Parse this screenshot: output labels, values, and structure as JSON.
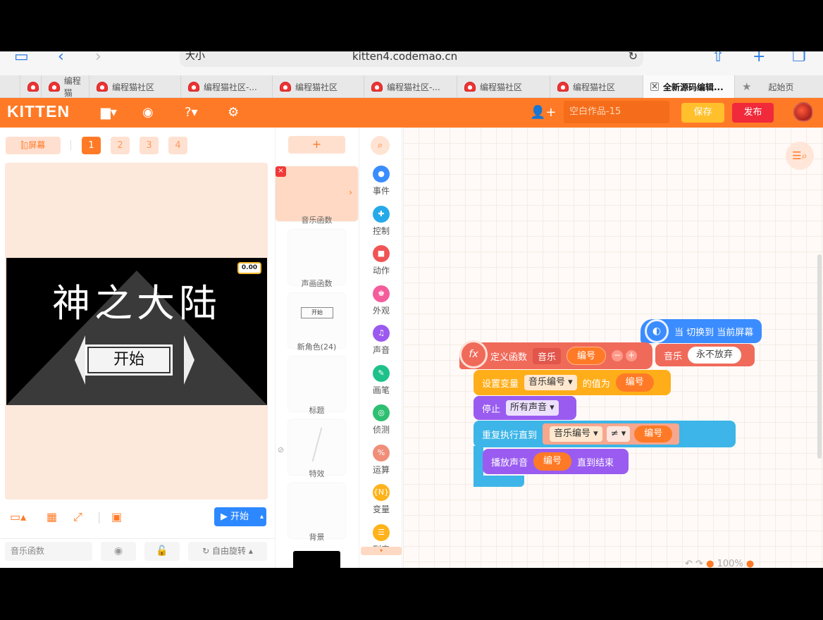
{
  "browser": {
    "url_left": "大小",
    "url": "kitten4.codemao.cn"
  },
  "tabs": [
    {
      "label": "编程猫",
      "active": false
    },
    {
      "label": "编程猫社区",
      "active": false
    },
    {
      "label": "编程猫社区-...",
      "active": false
    },
    {
      "label": "编程猫社区",
      "active": false
    },
    {
      "label": "编程猫社区-...",
      "active": false
    },
    {
      "label": "编程猫社区",
      "active": false
    },
    {
      "label": "编程猫社区",
      "active": false
    },
    {
      "label": "全新源码编辑...",
      "active": true
    },
    {
      "label": "起始页",
      "active": false
    }
  ],
  "header": {
    "logo": "KITTEN",
    "work_name": "空白作品-15",
    "save_label": "保存",
    "publish_label": "发布"
  },
  "stage": {
    "screen_label": "屏幕",
    "pages": [
      "1",
      "2",
      "3",
      "4"
    ],
    "active_page": "1",
    "title": "神之大陆",
    "button_label": "开始",
    "timer": "0.00",
    "start_label": "开始",
    "sprite_name": "音乐函数",
    "rotate_label": "自由旋转"
  },
  "sprites": {
    "add_label": "+",
    "items": [
      {
        "label": "音乐函数",
        "active": true
      },
      {
        "label": "声画函数",
        "active": false
      },
      {
        "label": "新角色(24)",
        "active": false
      },
      {
        "label": "标题",
        "active": false
      },
      {
        "label": "特效",
        "active": false
      },
      {
        "label": "背景",
        "active": false
      }
    ],
    "mini_button": "开始"
  },
  "categories": [
    {
      "label": "事件",
      "color": "#3b8cff",
      "icon": "●"
    },
    {
      "label": "控制",
      "color": "#26a9e8",
      "icon": "✚"
    },
    {
      "label": "动作",
      "color": "#f05454",
      "icon": "■"
    },
    {
      "label": "外观",
      "color": "#f45c9b",
      "icon": "♚"
    },
    {
      "label": "声音",
      "color": "#9b59f0",
      "icon": "♫"
    },
    {
      "label": "画笔",
      "color": "#1fc18b",
      "icon": "✎"
    },
    {
      "label": "侦测",
      "color": "#2fbf71",
      "icon": "◎"
    },
    {
      "label": "运算",
      "color": "#f08e7a",
      "icon": "%"
    },
    {
      "label": "变量",
      "color": "#ffb21a",
      "icon": "{N}"
    },
    {
      "label": "列表",
      "color": "#ffb21a",
      "icon": "☰"
    }
  ],
  "blocks": {
    "hat_label": "当 切换到 当前屏幕",
    "define_label": "定义函数",
    "func_name": "音乐",
    "param": "编号",
    "call_label": "音乐",
    "call_arg": "永不放弃",
    "set_var_label": "设置变量",
    "var_name": "音乐编号",
    "value_label": "的值为",
    "value_param": "编号",
    "stop_label": "停止",
    "stop_option": "所有声音",
    "repeat_label": "重复执行直到",
    "cond_var": "音乐编号",
    "cond_op": "≠",
    "cond_param": "编号",
    "play_label": "播放声音",
    "play_param": "编号",
    "play_suffix": "直到结束"
  },
  "zoom": "100%"
}
